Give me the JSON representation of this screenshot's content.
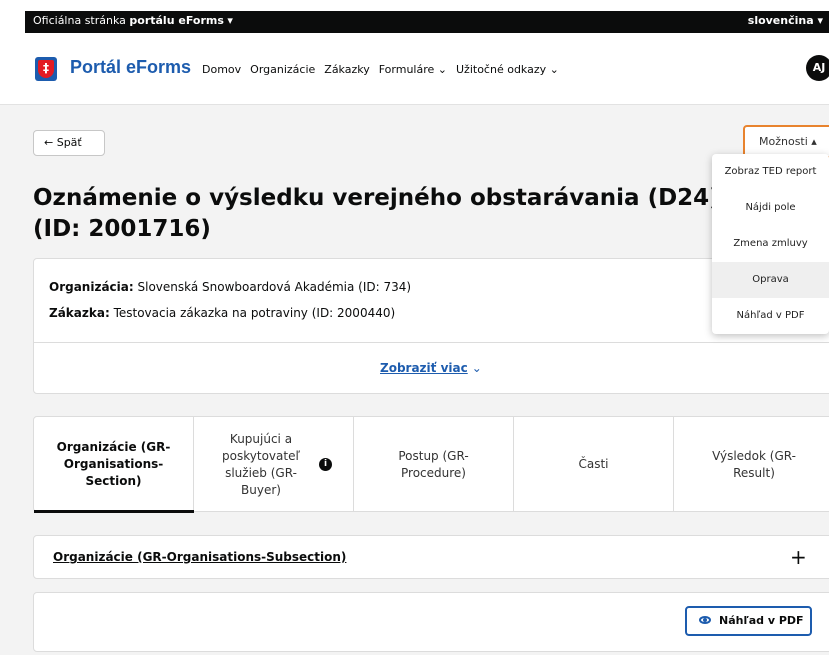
{
  "gov_bar": {
    "prefix": "Oficiálna stránka ",
    "bold": "portálu eForms",
    "chevron": " ▾",
    "language": "slovenčina ▾"
  },
  "header": {
    "logo_glyph": "‡",
    "brand": "Portál eForms",
    "nav": [
      "Domov",
      "Organizácie",
      "Zákazky",
      "Formuláre ⌄",
      "Užitočné odkazy ⌄"
    ],
    "avatar": "AJ"
  },
  "toolbar": {
    "back_label": "← Späť",
    "options_label": "Možnosti ▴"
  },
  "title": "Oznámenie o výsledku verejného obstarávania (D24) (ID: 2001716)",
  "info": {
    "organization_label": "Organizácia:",
    "organization_value": " Slovenská Snowboardová Akadémia (ID: 734)",
    "contract_label": "Zákazka:",
    "contract_value": " Testovacia zákazka na potraviny (ID: 2000440)",
    "show_more": "Zobraziť viac",
    "show_more_icon": "⌄"
  },
  "tabs": [
    "Organizácie (GR-Organisations-Section)",
    "Kupujúci a poskytovateľ služieb (GR-Buyer)",
    "Postup (GR-Procedure)",
    "Časti",
    "Výsledok (GR-Result)"
  ],
  "tab_info_icon": "i",
  "subsection": {
    "title": "Organizácie (GR-Organisations-Subsection)",
    "toggle": "+"
  },
  "bottom": {
    "pdf_button": "Náhľad v PDF"
  },
  "dropdown": {
    "items": [
      "Zobraz TED report",
      "Nájdi pole",
      "Zmena zmluvy",
      "Oprava",
      "Náhľad v PDF"
    ],
    "hovered_index": 3
  },
  "colors": {
    "accent": "#1d5cae",
    "options_border": "#e8832e",
    "gov_bar": "#0b0c0c"
  }
}
